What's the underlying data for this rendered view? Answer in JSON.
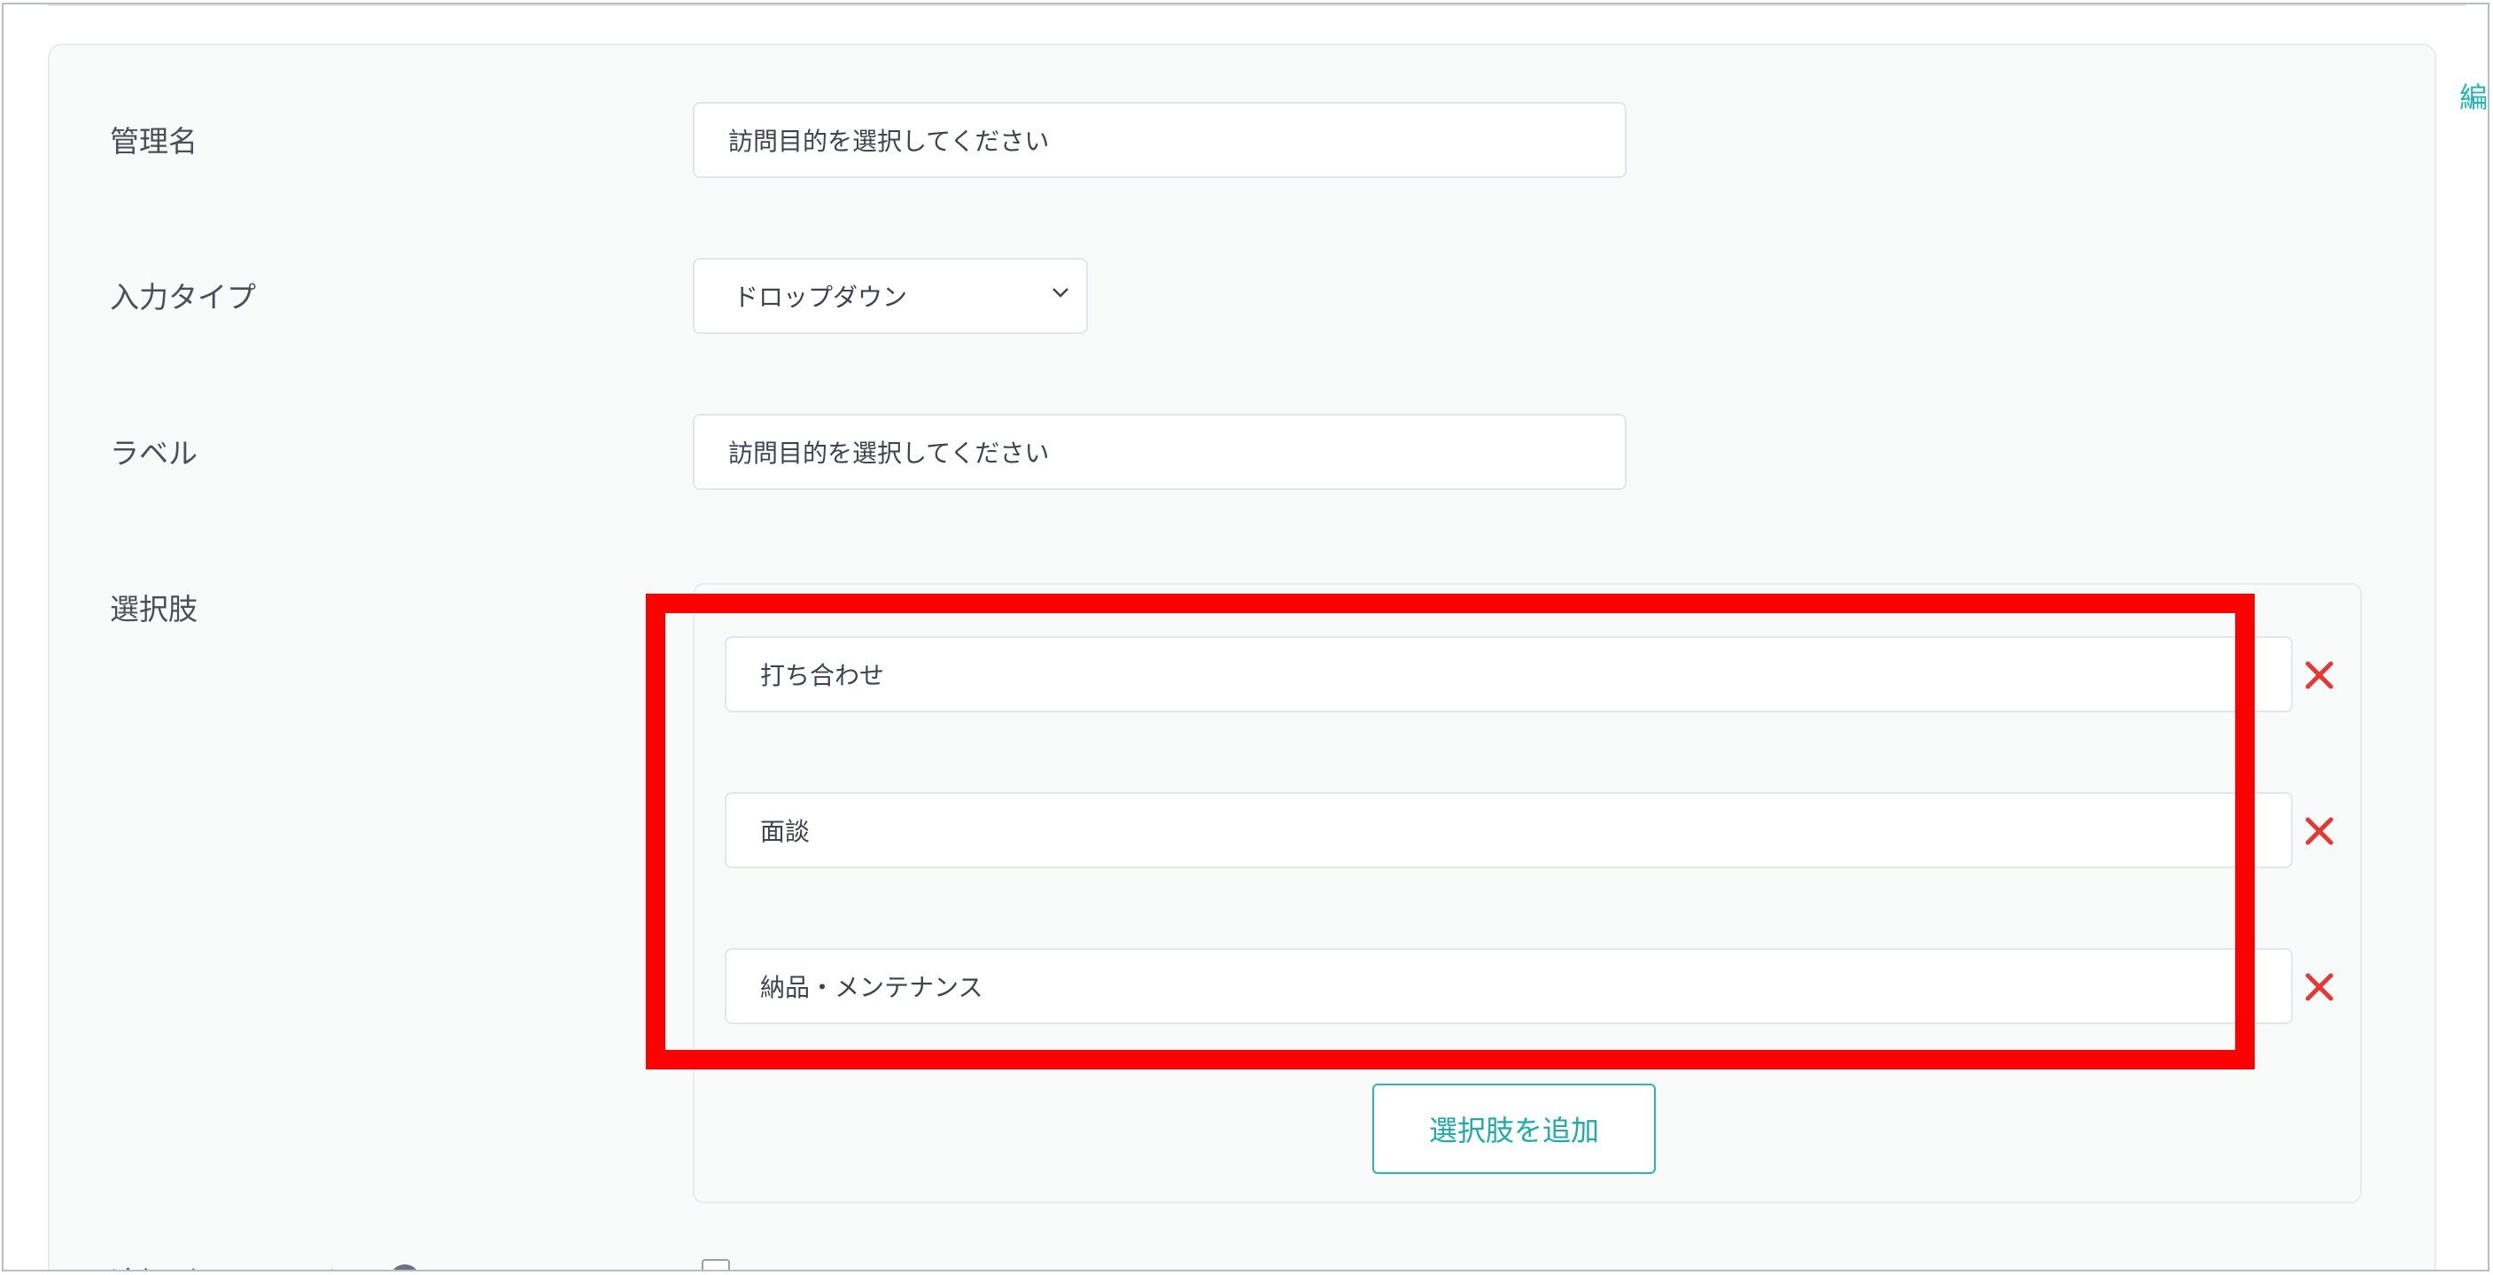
{
  "header": {
    "edit_link": "編"
  },
  "form": {
    "admin_name": {
      "label": "管理名",
      "value": "訪問目的を選択してください"
    },
    "input_type": {
      "label": "入力タイプ",
      "value": "ドロップダウン"
    },
    "field_label": {
      "label": "ラベル",
      "value": "訪問目的を選択してください"
    },
    "options": {
      "label": "選択肢",
      "items": [
        {
          "value": "打ち合わせ"
        },
        {
          "value": "面談"
        },
        {
          "value": "納品・メンテナンス"
        }
      ],
      "add_button": "選択肢を追加"
    },
    "extra_guest": {
      "label": "追加ゲスト用にする"
    }
  },
  "icons": {
    "remove": "close-icon",
    "dropdown": "chevron-down-icon",
    "help": "help-icon"
  },
  "colors": {
    "accent": "#22b3b3",
    "remove": "#e53935",
    "highlight": "#ff0000"
  }
}
